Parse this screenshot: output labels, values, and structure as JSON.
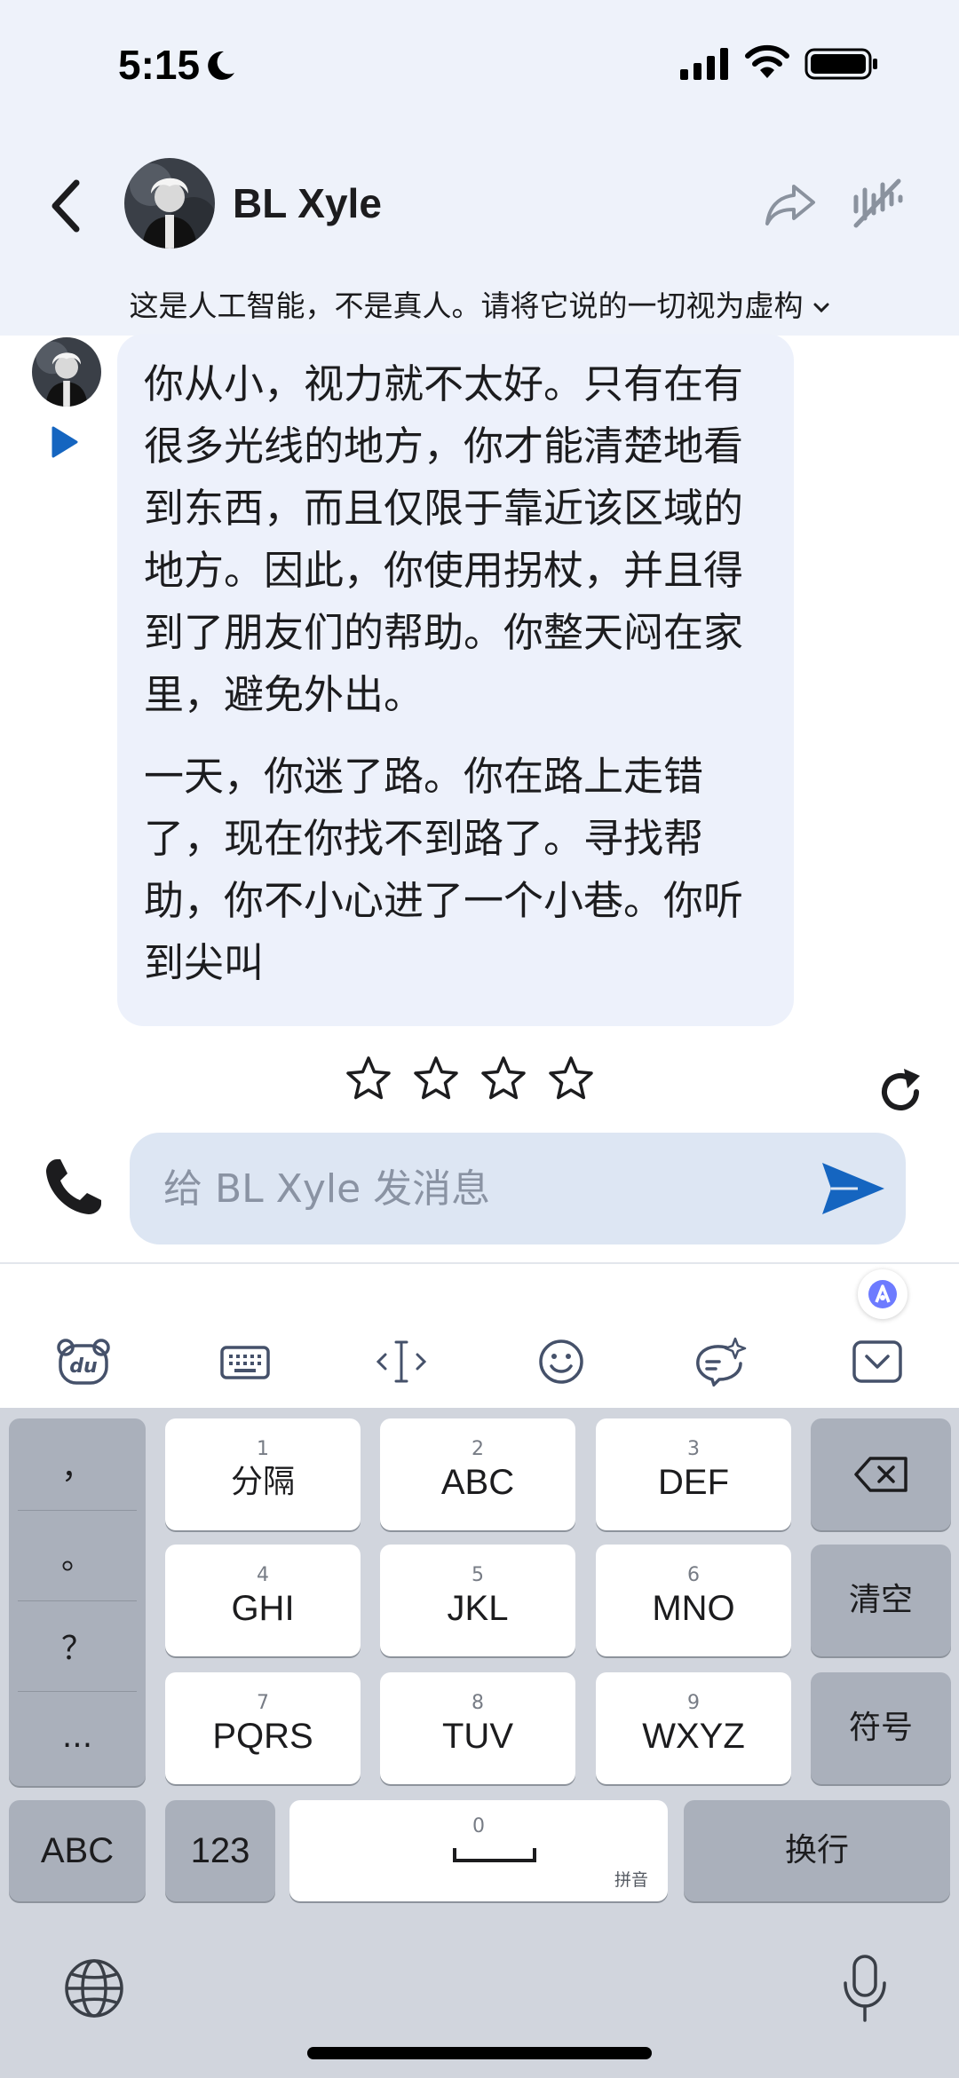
{
  "status_bar": {
    "time": "5:15"
  },
  "header": {
    "character_name": "BL Xyle",
    "disclaimer": "这是人工智能，不是真人。请将它说的一切视为虚构"
  },
  "message": {
    "paragraphs": [
      "你从小，视力就不太好。只有在有很多光线的地方，你才能清楚地看到东西，而且仅限于靠近该区域的地方。因此，你使用拐杖，并且得到了朋友们的帮助。你整天闷在家里，避免外出。",
      "一天，你迷了路。你在路上走错了，现在你找不到路了。寻找帮助，你不小心进了一个小巷。你听到尖叫"
    ],
    "rating": {
      "max": 5,
      "value": 0
    }
  },
  "composer": {
    "placeholder": "给 BL Xyle 发消息"
  },
  "keyboard": {
    "punctuation": [
      "，",
      "。",
      "？",
      "..."
    ],
    "keys": [
      {
        "num": "1",
        "label": "分隔"
      },
      {
        "num": "2",
        "label": "ABC"
      },
      {
        "num": "3",
        "label": "DEF"
      },
      {
        "num": "4",
        "label": "GHI"
      },
      {
        "num": "5",
        "label": "JKL"
      },
      {
        "num": "6",
        "label": "MNO"
      },
      {
        "num": "7",
        "label": "PQRS"
      },
      {
        "num": "8",
        "label": "TUV"
      },
      {
        "num": "9",
        "label": "WXYZ"
      }
    ],
    "clear_label": "清空",
    "symbols_label": "符号",
    "abc_label": "ABC",
    "num_label": "123",
    "space_num": "0",
    "space_hint": "拼音",
    "return_label": "换行"
  },
  "colors": {
    "accent": "#1565c0",
    "bubble": "#edf1fb",
    "header_bg": "#eef2fa",
    "keyboard_bg": "#d1d5dd"
  },
  "icons": [
    "moon-icon",
    "signal-icon",
    "wifi-icon",
    "battery-icon",
    "back-arrow-icon",
    "share-icon",
    "mute-icon",
    "chevron-down-icon",
    "play-icon",
    "star-icon",
    "refresh-icon",
    "phone-icon",
    "send-icon",
    "ai-assistant-icon",
    "baidu-input-icon",
    "keyboard-icon",
    "cursor-icon",
    "emoji-icon",
    "sparkle-chat-icon",
    "collapse-icon",
    "backspace-icon",
    "globe-icon",
    "microphone-icon"
  ]
}
